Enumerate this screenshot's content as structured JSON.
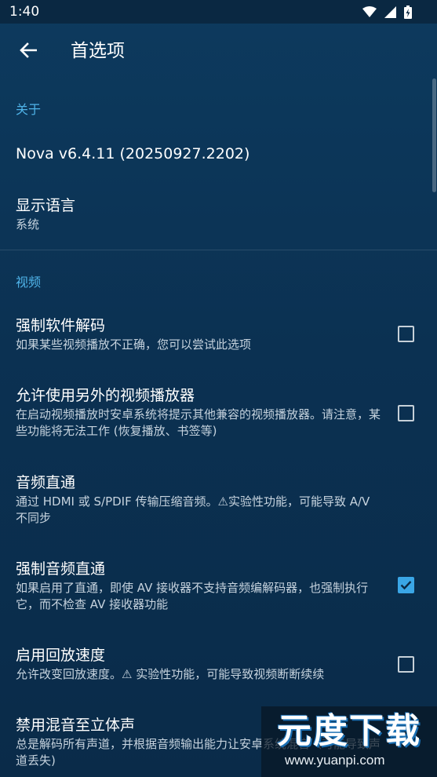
{
  "status_bar": {
    "time": "1:40"
  },
  "app_bar": {
    "back_icon": "arrow-left-icon",
    "title": "首选项"
  },
  "sections": {
    "about": {
      "header": "关于",
      "version": "Nova v6.4.11 (20250927.2202)",
      "language_title": "显示语言",
      "language_value": "系统"
    },
    "video": {
      "header": "视频",
      "items": [
        {
          "title": "强制软件解码",
          "summary": "如果某些视频播放不正确，您可以尝试此选项",
          "checked": false
        },
        {
          "title": "允许使用另外的视频播放器",
          "summary": "在启动视频播放时安卓系统将提示其他兼容的视频播放器。请注意，某些功能将无法工作 (恢复播放、书签等)",
          "checked": false
        },
        {
          "title": "音频直通",
          "summary": "通过 HDMI 或 S/PDIF 传输压缩音频。⚠实验性功能，可能导致 A/V 不同步"
        },
        {
          "title": "强制音频直通",
          "summary": "如果启用了直通，即使 AV 接收器不支持音频编解码器，也强制执行它，而不检查 AV 接收器功能",
          "checked": true
        },
        {
          "title": "启用回放速度",
          "summary": "允许改变回放速度。⚠ 实验性功能，可能导致视频断断续续",
          "checked": false
        },
        {
          "title": "禁用混音至立体声",
          "summary": "总是解码所有声道，并根据音频输出能力让安卓系统混音（可能导致声道丢失)"
        }
      ]
    }
  },
  "watermark": {
    "logo": "元度下载",
    "url": "www.yuanpi.com"
  },
  "colors": {
    "accent": "#4fb3e8",
    "checkbox_checked": "#3aa6e6",
    "background": "#0b3152"
  }
}
